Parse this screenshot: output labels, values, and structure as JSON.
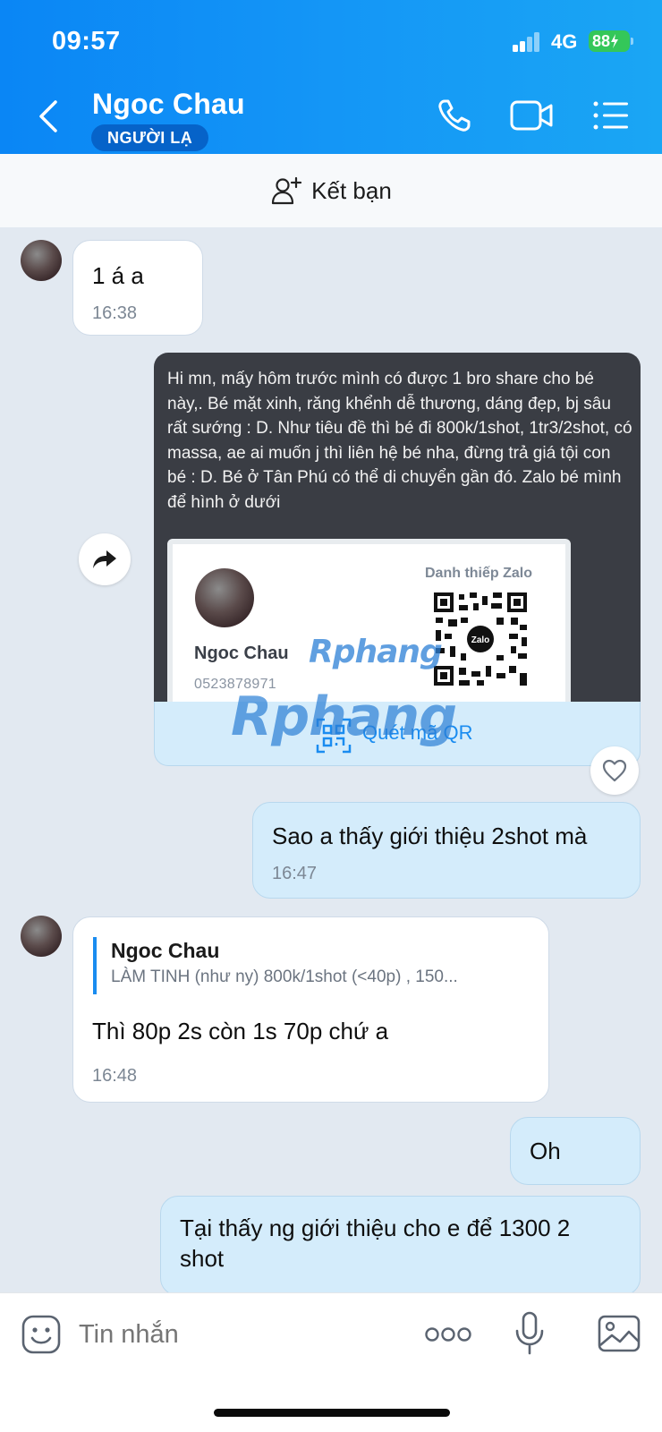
{
  "status_bar": {
    "time": "09:57",
    "network": "4G",
    "battery": "88"
  },
  "header": {
    "title": "Ngoc Chau",
    "badge": "NGƯỜI LẠ"
  },
  "add_friend": {
    "label": "Kết bạn"
  },
  "messages": {
    "m1": {
      "text": "1 á a",
      "time": "16:38"
    },
    "forward": {
      "text": "Hi mn, mấy hôm trước mình có được 1 bro share cho bé này,. Bé mặt xinh, răng khểnh dễ thương, dáng đẹp, bj sâu rất sướng : D. Như tiêu đề thì bé đi 800k/1shot, 1tr3/2shot, có massa, ae ai muốn j thì liên hệ bé nha, đừng trả giá tội con bé : D. Bé ở Tân Phú có thể di chuyển gần đó. Zalo bé mình để hình ở dưới",
      "card": {
        "label": "Danh thiếp Zalo",
        "name": "Ngoc Chau",
        "phone": "0523878971",
        "qr_logo": "Zalo"
      },
      "qr_button": "Quét mã QR"
    },
    "m3": {
      "text": "Sao a thấy giới thiệu 2shot mà",
      "time": "16:47"
    },
    "m4": {
      "quote_name": "Ngoc Chau",
      "quote_text": "LÀM TINH (như ny) 800k/1shot (<40p) , 150...",
      "text": "Thì 80p 2s còn 1s 70p chứ a",
      "time": "16:48"
    },
    "m5": {
      "text": "Oh"
    },
    "m6": {
      "text": "Tại thấy ng giới thiệu cho e để 1300 2 shot"
    }
  },
  "watermark": "Rphang",
  "input": {
    "placeholder": "Tin nhắn"
  },
  "colors": {
    "header": "#1496f6",
    "outgoing_bubble": "#d4ecfb",
    "background": "#e2e9f1",
    "accent": "#1a8cf0"
  }
}
